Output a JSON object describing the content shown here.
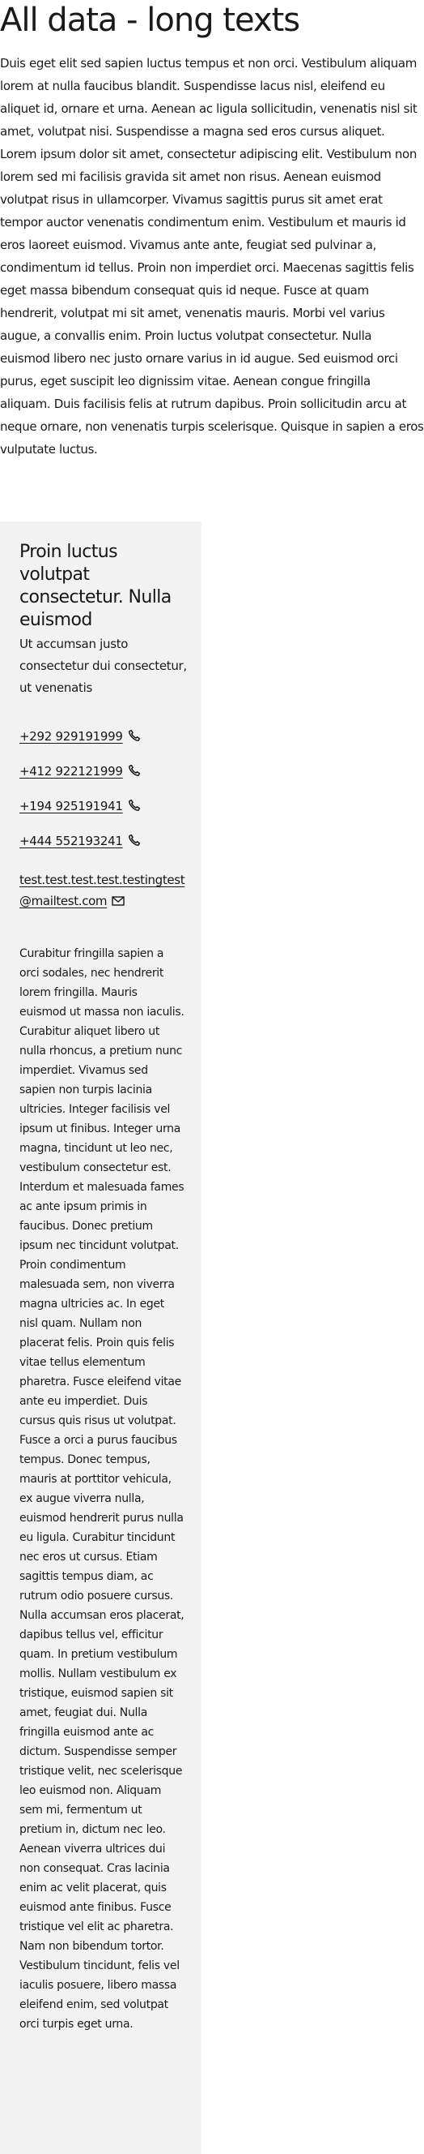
{
  "page": {
    "title": "All data - long texts",
    "intro": "Duis eget elit sed sapien luctus tempus et non orci. Vestibulum aliquam lorem at nulla faucibus blandit. Suspendisse lacus nisl, eleifend eu aliquet id, ornare et urna. Aenean ac ligula sollicitudin, venenatis nisl sit amet, volutpat nisi. Suspendisse a magna sed eros cursus aliquet. Lorem ipsum dolor sit amet, consectetur adipiscing elit. Vestibulum non lorem sed mi facilisis gravida sit amet non risus. Aenean euismod volutpat risus in ullamcorper. Vivamus sagittis purus sit amet erat tempor auctor venenatis condimentum enim. Vestibulum et mauris id eros laoreet euismod. Vivamus ante ante, feugiat sed pulvinar a, condimentum id tellus. Proin non imperdiet orci. Maecenas sagittis felis eget massa bibendum consequat quis id neque. Fusce at quam hendrerit, volutpat mi sit amet, venenatis mauris. Morbi vel varius augue, a convallis enim. Proin luctus volutpat consectetur. Nulla euismod libero nec justo ornare varius in id augue. Sed euismod orci purus, eget suscipit leo dignissim vitae. Aenean congue fringilla aliquam. Duis facilisis felis at rutrum dapibus. Proin sollicitudin arcu at neque ornare, non venenatis turpis scelerisque. Quisque in sapien a eros vulputate luctus."
  },
  "card": {
    "heading": "Proin luctus volutpat consectetur. Nulla euismod",
    "subtitle": "Ut accumsan justo consectetur dui consectetur, ut venenatis",
    "phones": [
      {
        "number": "+292 929191999",
        "icon": "phone-icon"
      },
      {
        "number": "+412 922121999",
        "icon": "phone-icon"
      },
      {
        "number": "+194 925191941",
        "icon": "phone-icon"
      },
      {
        "number": "+444 552193241",
        "icon": "phone-icon"
      }
    ],
    "email": "test.test.test.test.testingtest@mailtest.com",
    "email_icon": "mail-icon",
    "body": "Curabitur fringilla sapien a orci sodales, nec hendrerit lorem fringilla. Mauris euismod ut massa non iaculis. Curabitur aliquet libero ut nulla rhoncus, a pretium nunc imperdiet. Vivamus sed sapien non turpis lacinia ultricies. Integer facilisis vel ipsum ut finibus. Integer urna magna, tincidunt ut leo nec, vestibulum consectetur est. Interdum et malesuada fames ac ante ipsum primis in faucibus. Donec pretium ipsum nec tincidunt volutpat. Proin condimentum malesuada sem, non viverra magna ultricies ac. In eget nisl quam. Nullam non placerat felis. Proin quis felis vitae tellus elementum pharetra. Fusce eleifend vitae ante eu imperdiet. Duis cursus quis risus ut volutpat. Fusce a orci a purus faucibus tempus. Donec tempus, mauris at porttitor vehicula, ex augue viverra nulla, euismod hendrerit purus nulla eu ligula. Curabitur tincidunt nec eros ut cursus. Etiam sagittis tempus diam, ac rutrum odio posuere cursus. Nulla accumsan eros placerat, dapibus tellus vel, efficitur quam. In pretium vestibulum mollis. Nullam vestibulum ex tristique, euismod sapien sit amet, feugiat dui. Nulla fringilla euismod ante ac dictum. Suspendisse semper tristique velit, nec scelerisque leo euismod non. Aliquam sem mi, fermentum ut pretium in, dictum nec leo. Aenean viverra ultrices dui non consequat. Cras lacinia enim ac velit placerat, quis euismod ante finibus. Fusce tristique vel elit ac pharetra. Nam non bibendum tortor. Vestibulum tincidunt, felis vel iaculis posuere, libero massa eleifend enim, sed volutpat orci turpis eget urna."
  },
  "colors": {
    "text": "#1a1a1a",
    "card_background": "#f2f2f2",
    "page_background": "#ffffff"
  }
}
